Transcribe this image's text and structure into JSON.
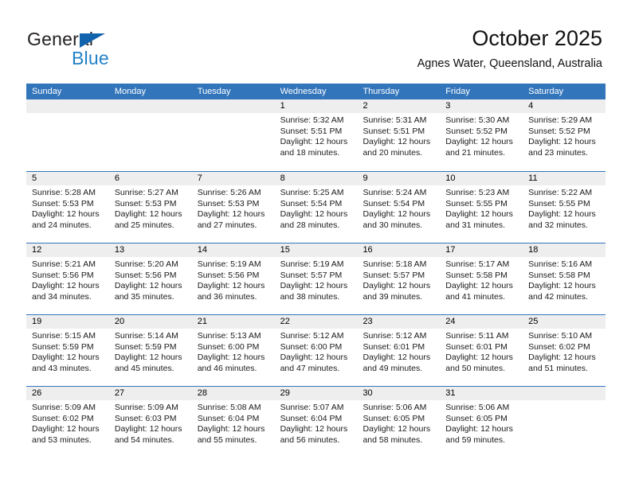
{
  "brand": {
    "name_part1": "General",
    "name_part2": "Blue",
    "triangle_color": "#1263ae",
    "blue_color": "#2281c8"
  },
  "header": {
    "title": "October 2025",
    "subtitle": "Agnes Water, Queensland, Australia"
  },
  "theme": {
    "header_blue": "#3275bb",
    "day_band_gray": "#eeeeee"
  },
  "weekdays": [
    "Sunday",
    "Monday",
    "Tuesday",
    "Wednesday",
    "Thursday",
    "Friday",
    "Saturday"
  ],
  "weeks": [
    [
      {
        "day": "",
        "sunrise": "",
        "sunset": "",
        "daylight_line1": "",
        "daylight_line2": "",
        "empty": true
      },
      {
        "day": "",
        "sunrise": "",
        "sunset": "",
        "daylight_line1": "",
        "daylight_line2": "",
        "empty": true
      },
      {
        "day": "",
        "sunrise": "",
        "sunset": "",
        "daylight_line1": "",
        "daylight_line2": "",
        "empty": true
      },
      {
        "day": "1",
        "sunrise": "Sunrise: 5:32 AM",
        "sunset": "Sunset: 5:51 PM",
        "daylight_line1": "Daylight: 12 hours",
        "daylight_line2": "and 18 minutes."
      },
      {
        "day": "2",
        "sunrise": "Sunrise: 5:31 AM",
        "sunset": "Sunset: 5:51 PM",
        "daylight_line1": "Daylight: 12 hours",
        "daylight_line2": "and 20 minutes."
      },
      {
        "day": "3",
        "sunrise": "Sunrise: 5:30 AM",
        "sunset": "Sunset: 5:52 PM",
        "daylight_line1": "Daylight: 12 hours",
        "daylight_line2": "and 21 minutes."
      },
      {
        "day": "4",
        "sunrise": "Sunrise: 5:29 AM",
        "sunset": "Sunset: 5:52 PM",
        "daylight_line1": "Daylight: 12 hours",
        "daylight_line2": "and 23 minutes."
      }
    ],
    [
      {
        "day": "5",
        "sunrise": "Sunrise: 5:28 AM",
        "sunset": "Sunset: 5:53 PM",
        "daylight_line1": "Daylight: 12 hours",
        "daylight_line2": "and 24 minutes."
      },
      {
        "day": "6",
        "sunrise": "Sunrise: 5:27 AM",
        "sunset": "Sunset: 5:53 PM",
        "daylight_line1": "Daylight: 12 hours",
        "daylight_line2": "and 25 minutes."
      },
      {
        "day": "7",
        "sunrise": "Sunrise: 5:26 AM",
        "sunset": "Sunset: 5:53 PM",
        "daylight_line1": "Daylight: 12 hours",
        "daylight_line2": "and 27 minutes."
      },
      {
        "day": "8",
        "sunrise": "Sunrise: 5:25 AM",
        "sunset": "Sunset: 5:54 PM",
        "daylight_line1": "Daylight: 12 hours",
        "daylight_line2": "and 28 minutes."
      },
      {
        "day": "9",
        "sunrise": "Sunrise: 5:24 AM",
        "sunset": "Sunset: 5:54 PM",
        "daylight_line1": "Daylight: 12 hours",
        "daylight_line2": "and 30 minutes."
      },
      {
        "day": "10",
        "sunrise": "Sunrise: 5:23 AM",
        "sunset": "Sunset: 5:55 PM",
        "daylight_line1": "Daylight: 12 hours",
        "daylight_line2": "and 31 minutes."
      },
      {
        "day": "11",
        "sunrise": "Sunrise: 5:22 AM",
        "sunset": "Sunset: 5:55 PM",
        "daylight_line1": "Daylight: 12 hours",
        "daylight_line2": "and 32 minutes."
      }
    ],
    [
      {
        "day": "12",
        "sunrise": "Sunrise: 5:21 AM",
        "sunset": "Sunset: 5:56 PM",
        "daylight_line1": "Daylight: 12 hours",
        "daylight_line2": "and 34 minutes."
      },
      {
        "day": "13",
        "sunrise": "Sunrise: 5:20 AM",
        "sunset": "Sunset: 5:56 PM",
        "daylight_line1": "Daylight: 12 hours",
        "daylight_line2": "and 35 minutes."
      },
      {
        "day": "14",
        "sunrise": "Sunrise: 5:19 AM",
        "sunset": "Sunset: 5:56 PM",
        "daylight_line1": "Daylight: 12 hours",
        "daylight_line2": "and 36 minutes."
      },
      {
        "day": "15",
        "sunrise": "Sunrise: 5:19 AM",
        "sunset": "Sunset: 5:57 PM",
        "daylight_line1": "Daylight: 12 hours",
        "daylight_line2": "and 38 minutes."
      },
      {
        "day": "16",
        "sunrise": "Sunrise: 5:18 AM",
        "sunset": "Sunset: 5:57 PM",
        "daylight_line1": "Daylight: 12 hours",
        "daylight_line2": "and 39 minutes."
      },
      {
        "day": "17",
        "sunrise": "Sunrise: 5:17 AM",
        "sunset": "Sunset: 5:58 PM",
        "daylight_line1": "Daylight: 12 hours",
        "daylight_line2": "and 41 minutes."
      },
      {
        "day": "18",
        "sunrise": "Sunrise: 5:16 AM",
        "sunset": "Sunset: 5:58 PM",
        "daylight_line1": "Daylight: 12 hours",
        "daylight_line2": "and 42 minutes."
      }
    ],
    [
      {
        "day": "19",
        "sunrise": "Sunrise: 5:15 AM",
        "sunset": "Sunset: 5:59 PM",
        "daylight_line1": "Daylight: 12 hours",
        "daylight_line2": "and 43 minutes."
      },
      {
        "day": "20",
        "sunrise": "Sunrise: 5:14 AM",
        "sunset": "Sunset: 5:59 PM",
        "daylight_line1": "Daylight: 12 hours",
        "daylight_line2": "and 45 minutes."
      },
      {
        "day": "21",
        "sunrise": "Sunrise: 5:13 AM",
        "sunset": "Sunset: 6:00 PM",
        "daylight_line1": "Daylight: 12 hours",
        "daylight_line2": "and 46 minutes."
      },
      {
        "day": "22",
        "sunrise": "Sunrise: 5:12 AM",
        "sunset": "Sunset: 6:00 PM",
        "daylight_line1": "Daylight: 12 hours",
        "daylight_line2": "and 47 minutes."
      },
      {
        "day": "23",
        "sunrise": "Sunrise: 5:12 AM",
        "sunset": "Sunset: 6:01 PM",
        "daylight_line1": "Daylight: 12 hours",
        "daylight_line2": "and 49 minutes."
      },
      {
        "day": "24",
        "sunrise": "Sunrise: 5:11 AM",
        "sunset": "Sunset: 6:01 PM",
        "daylight_line1": "Daylight: 12 hours",
        "daylight_line2": "and 50 minutes."
      },
      {
        "day": "25",
        "sunrise": "Sunrise: 5:10 AM",
        "sunset": "Sunset: 6:02 PM",
        "daylight_line1": "Daylight: 12 hours",
        "daylight_line2": "and 51 minutes."
      }
    ],
    [
      {
        "day": "26",
        "sunrise": "Sunrise: 5:09 AM",
        "sunset": "Sunset: 6:02 PM",
        "daylight_line1": "Daylight: 12 hours",
        "daylight_line2": "and 53 minutes."
      },
      {
        "day": "27",
        "sunrise": "Sunrise: 5:09 AM",
        "sunset": "Sunset: 6:03 PM",
        "daylight_line1": "Daylight: 12 hours",
        "daylight_line2": "and 54 minutes."
      },
      {
        "day": "28",
        "sunrise": "Sunrise: 5:08 AM",
        "sunset": "Sunset: 6:04 PM",
        "daylight_line1": "Daylight: 12 hours",
        "daylight_line2": "and 55 minutes."
      },
      {
        "day": "29",
        "sunrise": "Sunrise: 5:07 AM",
        "sunset": "Sunset: 6:04 PM",
        "daylight_line1": "Daylight: 12 hours",
        "daylight_line2": "and 56 minutes."
      },
      {
        "day": "30",
        "sunrise": "Sunrise: 5:06 AM",
        "sunset": "Sunset: 6:05 PM",
        "daylight_line1": "Daylight: 12 hours",
        "daylight_line2": "and 58 minutes."
      },
      {
        "day": "31",
        "sunrise": "Sunrise: 5:06 AM",
        "sunset": "Sunset: 6:05 PM",
        "daylight_line1": "Daylight: 12 hours",
        "daylight_line2": "and 59 minutes."
      },
      {
        "day": "",
        "sunrise": "",
        "sunset": "",
        "daylight_line1": "",
        "daylight_line2": "",
        "empty": true
      }
    ]
  ]
}
